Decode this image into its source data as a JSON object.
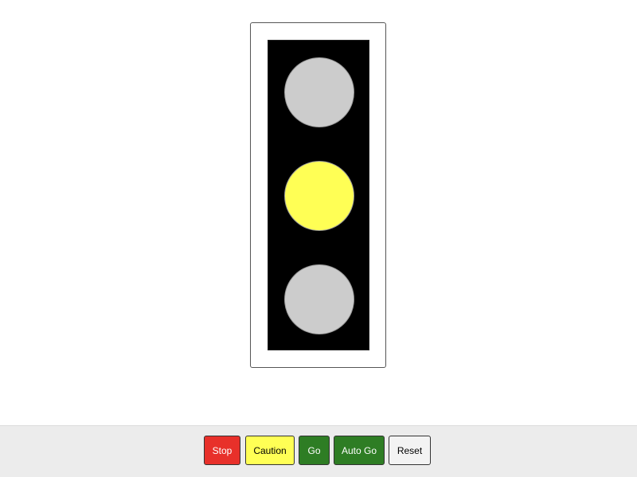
{
  "traffic_light": {
    "active": "yellow",
    "lamps": [
      {
        "id": "red",
        "color": "#cccccc"
      },
      {
        "id": "yellow",
        "color": "#ffff55"
      },
      {
        "id": "green",
        "color": "#cccccc"
      }
    ]
  },
  "controls": {
    "stop": {
      "label": "Stop",
      "bg": "#e8302a",
      "fg": "#ffffff"
    },
    "caution": {
      "label": "Caution",
      "bg": "#ffff55",
      "fg": "#000000"
    },
    "go": {
      "label": "Go",
      "bg": "#2e7d24",
      "fg": "#ffffff"
    },
    "auto_go": {
      "label": "Auto Go",
      "bg": "#2e7d24",
      "fg": "#ffffff"
    },
    "reset": {
      "label": "Reset",
      "bg": "#f3f3f3",
      "fg": "#000000"
    }
  }
}
